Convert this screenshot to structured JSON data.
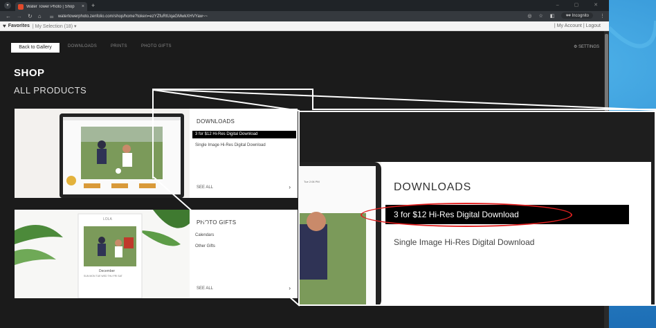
{
  "browser": {
    "tab_title": "Water Tower Photo | Shop",
    "tab_close": "×",
    "new_tab": "+",
    "url": "watertowerphoto.zenfolio.com/shop/home?token=ezYZfuRtUqaGMwkXHVYaw~~",
    "window_controls": "–  ▢  ✕",
    "incognito_label": "Incognito"
  },
  "bookmarks": {
    "favorites": "Favorites",
    "selection": "| My Selection (18) ▾",
    "right": "| My Account | Logout"
  },
  "nav": {
    "back_to_gallery": "Back to Gallery",
    "downloads": "DOWNLOADS",
    "prints": "PRINTS",
    "photo_gifts": "PHOTO GIFTS",
    "settings": "⚙ SETTINGS"
  },
  "page": {
    "title": "SHOP",
    "subtitle": "ALL PRODUCTS"
  },
  "card_downloads": {
    "title": "DOWNLOADS",
    "items": [
      "3 for $12 Hi-Res Digital Download",
      "Single Image Hi-Res Digital Download"
    ],
    "see_all": "SEE ALL"
  },
  "card_gifts": {
    "title": "PHOTO GIFTS",
    "items": [
      "Calendars",
      "Other Gifts"
    ],
    "see_all": "SEE ALL",
    "calendar_name": "LOLA",
    "calendar_month": "December",
    "calendar_days": "SUN MON TUE WED THU FRI SAT"
  },
  "zoom": {
    "title": "DOWNLOADS",
    "item_selected": "3 for $12 Hi-Res Digital Download",
    "item_other": "Single Image Hi-Res Digital Download",
    "time": "Tue 2:06 PM"
  },
  "colors": {
    "highlight_oval": "#e02020",
    "page_bg": "#1b1b1b",
    "accent_blue": "#2f8fd2"
  }
}
